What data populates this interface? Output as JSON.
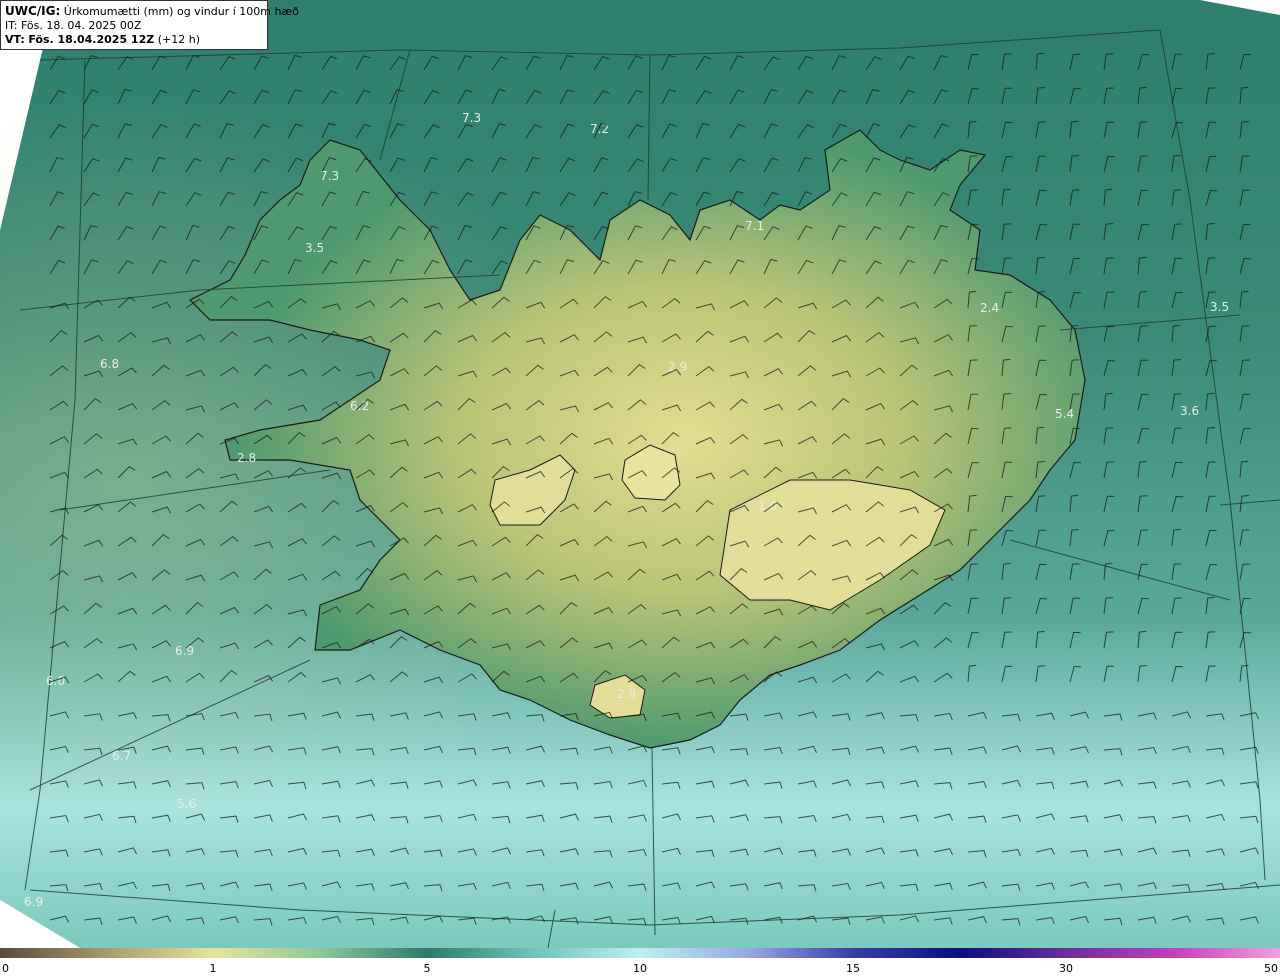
{
  "header": {
    "product": "UWC/IG:",
    "title": "Úrkomumætti (mm) og vindur í 100m hæð",
    "it_label": "IT:",
    "it_value": "Fös. 18. 04. 2025 00Z",
    "vt_label": "VT:",
    "vt_value": "Fös. 18.04.2025 12Z",
    "vt_offset": "(+12 h)"
  },
  "map_labels": [
    {
      "id": "l1",
      "text": "7.3"
    },
    {
      "id": "l2",
      "text": "7.2"
    },
    {
      "id": "l3",
      "text": "7.3"
    },
    {
      "id": "l4",
      "text": "3.5"
    },
    {
      "id": "l5",
      "text": "7.1"
    },
    {
      "id": "l6",
      "text": "2.4"
    },
    {
      "id": "l7",
      "text": "3.5"
    },
    {
      "id": "l8",
      "text": "6.8"
    },
    {
      "id": "l9",
      "text": "6.2"
    },
    {
      "id": "l10",
      "text": "2.8"
    },
    {
      "id": "l11",
      "text": "2.9"
    },
    {
      "id": "l12",
      "text": "5.4"
    },
    {
      "id": "l13",
      "text": "3.6"
    },
    {
      "id": "l14",
      "text": "1.0"
    },
    {
      "id": "l15",
      "text": "6.9"
    },
    {
      "id": "l16",
      "text": "6.0"
    },
    {
      "id": "l17",
      "text": "2.9"
    },
    {
      "id": "l18",
      "text": "6.7"
    },
    {
      "id": "l19",
      "text": "5.6"
    },
    {
      "id": "l20",
      "text": "6.9"
    }
  ],
  "colorbar": {
    "ticks": [
      "0",
      "1",
      "5",
      "10",
      "15",
      "30",
      "50"
    ],
    "stops": [
      "#5b4a3c",
      "#a89a6e",
      "#e8e39a",
      "#8fc79a",
      "#2f7a6c",
      "#6fc3b9",
      "#bfeef0",
      "#9aa9e6",
      "#3c3ca8",
      "#0c0c80",
      "#6b2f9c",
      "#c23fbf",
      "#f39ee0"
    ]
  }
}
